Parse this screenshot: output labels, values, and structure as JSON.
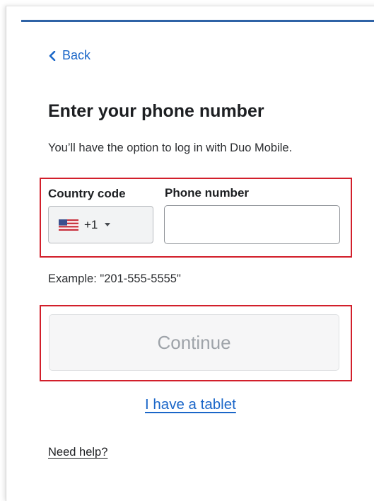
{
  "nav": {
    "back_label": "Back"
  },
  "header": {
    "title": "Enter your phone number",
    "subtitle": "You’ll have the option to log in with Duo Mobile."
  },
  "form": {
    "country_code_label": "Country code",
    "phone_number_label": "Phone number",
    "country_selected": "+1",
    "phone_value": "",
    "example_text": "Example: \"201-555-5555\""
  },
  "actions": {
    "continue_label": "Continue",
    "tablet_link": "I have a tablet",
    "help_link": "Need help?"
  },
  "colors": {
    "accent": "#2f63a6",
    "link": "#1a66c8",
    "highlight": "#d21f2b",
    "disabled_text": "#9ea3a9"
  }
}
